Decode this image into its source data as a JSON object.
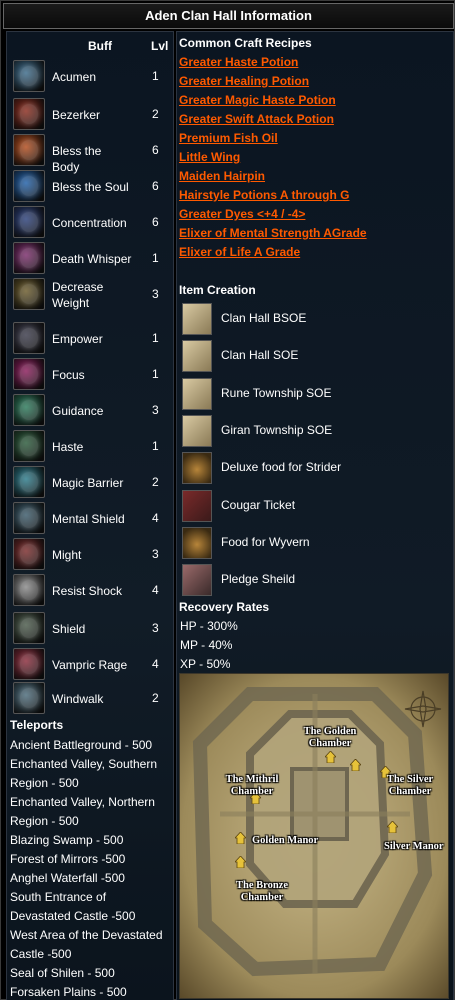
{
  "title": "Aden Clan Hall Information",
  "buffs": {
    "header_buff": "Buff",
    "header_lvl": "Lvl",
    "items": [
      {
        "name": "Acumen",
        "lvl": "1",
        "icon": "acumen-icon",
        "color": "#3b6a8a"
      },
      {
        "name": "Bezerker",
        "lvl": "2",
        "icon": "bezerker-icon",
        "color": "#8a2a1c"
      },
      {
        "name": "Bless the Body",
        "lvl": "6",
        "icon": "bless-the-body-icon",
        "color": "#b24a1a"
      },
      {
        "name": "Bless the Soul",
        "lvl": "6",
        "icon": "bless-the-soul-icon",
        "color": "#1f5fa8"
      },
      {
        "name": "Concentration",
        "lvl": "6",
        "icon": "concentration-icon",
        "color": "#2a3f7a"
      },
      {
        "name": "Death Whisper",
        "lvl": "1",
        "icon": "death-whisper-icon",
        "color": "#7a2a6a"
      },
      {
        "name": "Decrease Weight",
        "lvl": "3",
        "icon": "decrease-weight-icon",
        "color": "#6a5a2a"
      },
      {
        "name": "Empower",
        "lvl": "1",
        "icon": "empower-icon",
        "color": "#3a3a4a"
      },
      {
        "name": "Focus",
        "lvl": "1",
        "icon": "focus-icon",
        "color": "#8a1a5a"
      },
      {
        "name": "Guidance",
        "lvl": "3",
        "icon": "guidance-icon",
        "color": "#2a7a5a"
      },
      {
        "name": "Haste",
        "lvl": "1",
        "icon": "haste-icon",
        "color": "#2a5a3a"
      },
      {
        "name": "Magic Barrier",
        "lvl": "2",
        "icon": "magic-barrier-icon",
        "color": "#2a7a8a"
      },
      {
        "name": "Mental Shield",
        "lvl": "4",
        "icon": "mental-shield-icon",
        "color": "#3a5a6a"
      },
      {
        "name": "Might",
        "lvl": "3",
        "icon": "might-icon",
        "color": "#7a2a2a"
      },
      {
        "name": "Resist Shock",
        "lvl": "4",
        "icon": "resist-shock-icon",
        "color": "#8a8a8a"
      },
      {
        "name": "Shield",
        "lvl": "3",
        "icon": "shield-icon",
        "color": "#4a5a4a"
      },
      {
        "name": "Vampric Rage",
        "lvl": "4",
        "icon": "vampric-rage-icon",
        "color": "#8a2a3a"
      },
      {
        "name": "Windwalk",
        "lvl": "2",
        "icon": "windwalk-icon",
        "color": "#4a6a7a"
      }
    ]
  },
  "teleports": {
    "title": "Teleports",
    "lines": [
      "Ancient Battleground - 500",
      "Enchanted Valley, Southern",
      "Region - 500",
      "Enchanted Valley, Northern",
      "Region - 500",
      "Blazing Swamp - 500",
      "Forest of Mirrors -500",
      "Anghel Waterfall -500",
      "South Entrance of",
      "Devastated Castle -500",
      "West Area of the Devastated",
      "Castle -500",
      "Seal of Shilen - 500",
      "Forsaken Plains - 500"
    ]
  },
  "recipes": {
    "title": "Common Craft Recipes",
    "items": [
      "Greater Haste Potion",
      "Greater Healing Potion",
      "Greater Magic Haste Potion",
      "Greater Swift Attack Potion",
      "Premium Fish Oil",
      "Little Wing",
      "Maiden Hairpin",
      "Hairstyle Potions A through G",
      "Greater Dyes <+4 / -4>",
      "Elixer of Mental Strength AGrade",
      "Elixer of Life A Grade"
    ]
  },
  "item_creation": {
    "title": "Item Creation",
    "items": [
      {
        "name": "Clan Hall BSOE",
        "icon": "scroll-icon"
      },
      {
        "name": "Clan Hall SOE",
        "icon": "scroll-icon"
      },
      {
        "name": "Rune Township SOE",
        "icon": "scroll-icon"
      },
      {
        "name": "Giran Township SOE",
        "icon": "scroll-icon"
      },
      {
        "name": "Deluxe food for Strider",
        "icon": "food-bag-icon"
      },
      {
        "name": "Cougar Ticket",
        "icon": "ticket-icon"
      },
      {
        "name": "Food for Wyvern",
        "icon": "food-bag-icon"
      },
      {
        "name": "Pledge Sheild",
        "icon": "pledge-scroll-icon"
      }
    ]
  },
  "recovery": {
    "title": "Recovery Rates",
    "hp": "HP - 300%",
    "mp": "MP - 40%",
    "xp": "XP - 50%"
  },
  "map": {
    "labels": {
      "golden_chamber": "The Golden Chamber",
      "mithril_chamber": "The Mithril Chamber",
      "silver_chamber": "The Silver Chamber",
      "golden_manor": "Golden Manor",
      "silver_manor": "Silver Manor",
      "bronze_chamber": "The Bronze Chamber"
    }
  },
  "colors": {
    "link": "#ff5a00",
    "panel": "#0f1a25"
  }
}
